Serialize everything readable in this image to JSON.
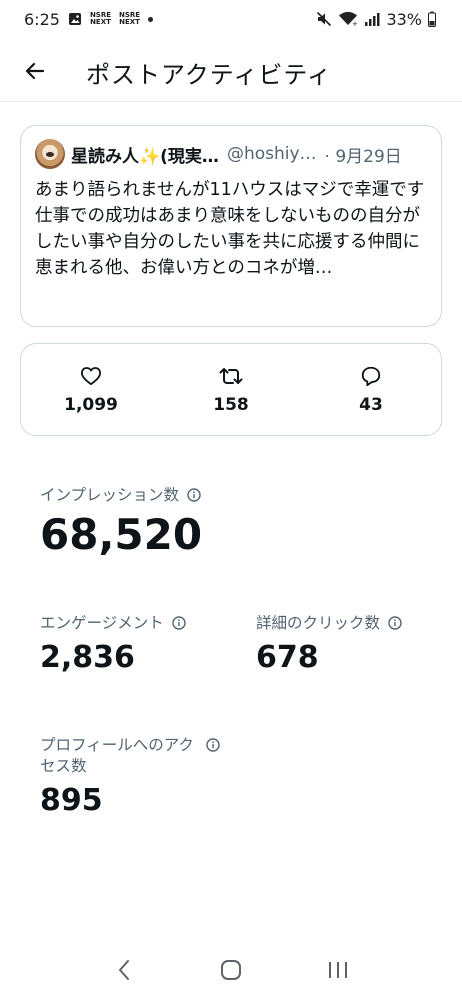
{
  "status_bar": {
    "time": "6:25",
    "badge1_line1": "NSRE",
    "badge1_line2": "NEXT",
    "badge2_line1": "NSRE",
    "badge2_line2": "NEXT",
    "battery": "33%"
  },
  "header": {
    "title": "ポストアクティビティ"
  },
  "tweet": {
    "display_name": "星読み人✨(現実…",
    "handle": "@hoshiy…",
    "date": "· 9月29日",
    "text": "あまり語られませんが11ハウスはマジで幸運です\n仕事での成功はあまり意味をしないものの自分がしたい事や自分のしたい事を共に応援する仲間に恵まれる他、お偉い方とのコネが増…"
  },
  "stats": {
    "likes": "1,099",
    "retweets": "158",
    "replies": "43"
  },
  "metrics": {
    "impressions_label": "インプレッション数",
    "impressions_value": "68,520",
    "engagements_label": "エンゲージメント",
    "engagements_value": "2,836",
    "detail_clicks_label": "詳細のクリック数",
    "detail_clicks_value": "678",
    "profile_visits_label": "プロフィールへのアクセス数",
    "profile_visits_value": "895"
  },
  "icons": {
    "back": "arrow-left-icon",
    "like": "heart-icon",
    "retweet": "retweet-icon",
    "reply": "reply-bubble-icon",
    "info": "info-icon"
  },
  "colors": {
    "text": "#0f1419",
    "secondary": "#536471",
    "border": "#cfd9de"
  }
}
